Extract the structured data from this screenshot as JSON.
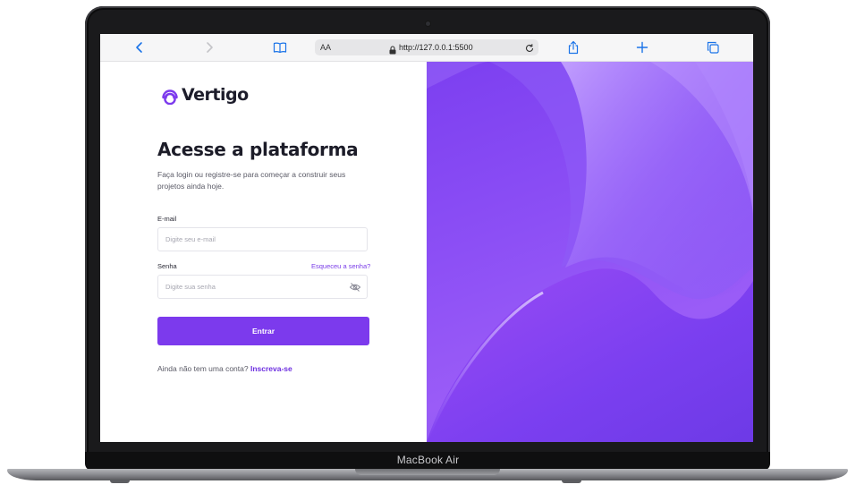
{
  "device": {
    "label": "MacBook Air"
  },
  "browser": {
    "address_prefix": "AA",
    "url": "http://127.0.0.1:5500",
    "icons": [
      "back-icon",
      "forward-icon",
      "bookmarks-icon",
      "lock-icon",
      "reload-icon",
      "share-icon",
      "new-tab-icon",
      "tabs-icon"
    ]
  },
  "brand": {
    "name": "Vertigo",
    "color": "#7c3aed"
  },
  "login": {
    "title": "Acesse a plataforma",
    "subtitle": "Faça login ou registre-se para começar a construir seus projetos ainda hoje.",
    "email_label": "E-mail",
    "email_placeholder": "Digite seu e-mail",
    "password_label": "Senha",
    "password_placeholder": "Digite sua senha",
    "forgot_link": "Esqueceu a senha?",
    "submit_label": "Entrar",
    "signup_prompt": "Ainda não tem uma conta?",
    "signup_link": "Inscreva-se"
  }
}
